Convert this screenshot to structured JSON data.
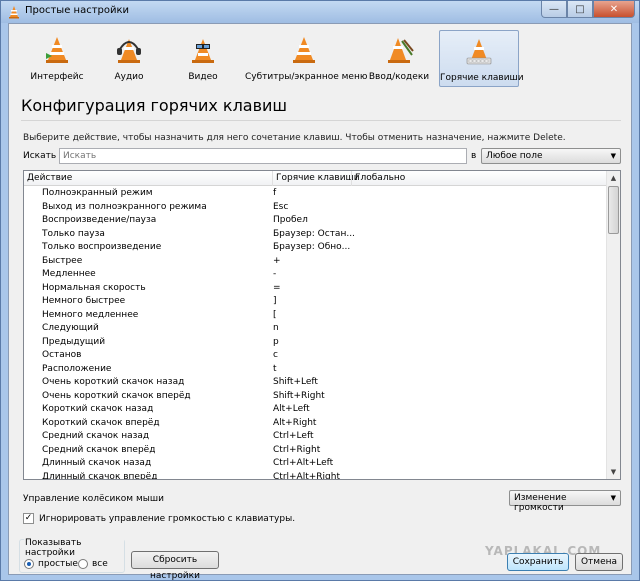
{
  "window": {
    "title": "Простые настройки",
    "close_label": "✕",
    "min_label": "—",
    "max_label": "□"
  },
  "categories": [
    {
      "label": "Интерфейс",
      "icon": "vlc-cone-interface-icon",
      "selected": false
    },
    {
      "label": "Аудио",
      "icon": "vlc-cone-headphones-icon",
      "selected": false
    },
    {
      "label": "Видео",
      "icon": "vlc-cone-video-icon",
      "selected": false
    },
    {
      "label": "Субтитры/экранное меню",
      "icon": "vlc-cone-subtitles-icon",
      "selected": false
    },
    {
      "label": "Ввод/кодеки",
      "icon": "vlc-cone-codecs-icon",
      "selected": false
    },
    {
      "label": "Горячие клавиши",
      "icon": "vlc-cone-hotkeys-icon",
      "selected": true
    }
  ],
  "section": {
    "title": "Конфигурация горячих клавиш",
    "instruction": "Выберите действие, чтобы назначить для него сочетание клавиш. Чтобы отменить назначение, нажмите Delete."
  },
  "search": {
    "label": "Искать",
    "placeholder": "Искать",
    "in_label": "в",
    "field_select": "Любое поле"
  },
  "table": {
    "columns": [
      "Действие",
      "Горячие клавиши",
      "Глобально"
    ],
    "rows": [
      [
        "Полноэкранный режим",
        "f"
      ],
      [
        "Выход из полноэкранного режима",
        "Esc"
      ],
      [
        "Воспроизведение/пауза",
        "Пробел"
      ],
      [
        "Только пауза",
        "Браузер: Остан..."
      ],
      [
        "Только воспроизведение",
        "Браузер: Обно..."
      ],
      [
        "Быстрее",
        "+"
      ],
      [
        "Медленнее",
        "-"
      ],
      [
        "Нормальная скорость",
        "="
      ],
      [
        "Немного быстрее",
        "]"
      ],
      [
        "Немного медленнее",
        "["
      ],
      [
        "Следующий",
        "n"
      ],
      [
        "Предыдущий",
        "p"
      ],
      [
        "Останов",
        "c"
      ],
      [
        "Расположение",
        "t"
      ],
      [
        "Очень короткий скачок назад",
        "Shift+Left"
      ],
      [
        "Очень короткий скачок вперёд",
        "Shift+Right"
      ],
      [
        "Короткий скачок назад",
        "Alt+Left"
      ],
      [
        "Короткий скачок вперёд",
        "Alt+Right"
      ],
      [
        "Средний скачок назад",
        "Ctrl+Left"
      ],
      [
        "Средний скачок вперёд",
        "Ctrl+Right"
      ],
      [
        "Длинный скачок назад",
        "Ctrl+Alt+Left"
      ],
      [
        "Длинный скачок вперёд",
        "Ctrl+Alt+Right"
      ]
    ]
  },
  "wheel": {
    "label": "Управление колёсиком мыши",
    "value": "Изменение громкости"
  },
  "ignore_volume": {
    "label": "Игнорировать управление громкостью с клавиатуры.",
    "checked": true
  },
  "show_settings": {
    "legend": "Показывать настройки",
    "simple_label": "простые",
    "all_label": "все",
    "selected": "simple"
  },
  "buttons": {
    "reset": "Сбросить настройки",
    "save": "Сохранить",
    "cancel": "Отмена"
  },
  "watermark": "YAPLAKAL.COM"
}
